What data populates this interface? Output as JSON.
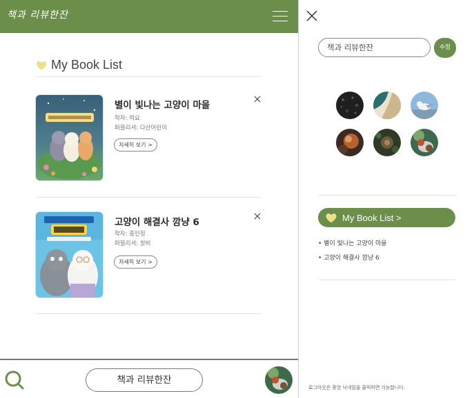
{
  "header": {
    "logo": "책과 리뷰한잔",
    "menu_icon": "hamburger-icon",
    "color": "#6b8e4a"
  },
  "list": {
    "title": "My Book List",
    "icon": "heart-icon",
    "books": [
      {
        "title": "별이 빛나는 고양이 마을",
        "author": "작자: 히요",
        "publisher": "퍼블리셔: 다산어린이",
        "detail_label": "자세히 보기 >",
        "close_icon": "close-icon"
      },
      {
        "title": "고양이 해결사 깜냥 6",
        "author": "작자: 홍민정",
        "publisher": "퍼블리셔: 창비",
        "detail_label": "자세히 보기 >",
        "close_icon": "close-icon"
      }
    ]
  },
  "bottom": {
    "search_icon": "search-icon",
    "title": "책과 리뷰한잔"
  },
  "side": {
    "close_icon": "close-icon",
    "nickname_value": "책과 리뷰한잔",
    "edit_label": "수정",
    "my_book_list_label": "My Book List >",
    "items": [
      "별이 빛나는 고양이 마을",
      "고양이 해결사 깜냥 6"
    ],
    "footnote": "로그아웃은 중앙 닉네임을 클릭하면 가능합니다."
  }
}
